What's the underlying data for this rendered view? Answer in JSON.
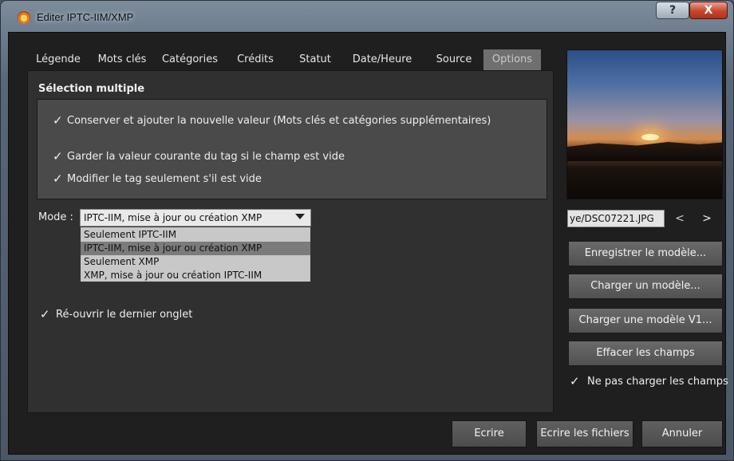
{
  "window": {
    "title": "Editer IPTC-IIM/XMP",
    "help_label": "?",
    "close_label": "X"
  },
  "tabs": [
    {
      "label": "Légende"
    },
    {
      "label": "Mots clés"
    },
    {
      "label": "Catégories"
    },
    {
      "label": "Crédits"
    },
    {
      "label": "Statut"
    },
    {
      "label": "Date/Heure"
    },
    {
      "label": "Source"
    },
    {
      "label": "Options",
      "active": true
    }
  ],
  "options": {
    "multi_title": "Sélection multiple",
    "checks": [
      {
        "label": "Conserver et ajouter la nouvelle valeur (Mots clés et catégories supplémentaires)",
        "checked": true
      },
      {
        "label": "Garder la valeur courante du tag si le champ est vide",
        "checked": true
      },
      {
        "label": "Modifier le tag seulement s'il est vide",
        "checked": true
      }
    ],
    "mode_label": "Mode :",
    "mode_value": "IPTC-IIM, mise à jour ou création XMP",
    "mode_options": [
      "Seulement IPTC-IIM",
      "IPTC-IIM, mise à jour ou création XMP",
      "Seulement XMP",
      "XMP, mise à jour ou création IPTC-IIM"
    ],
    "reopen_label": "Ré-ouvrir le dernier onglet",
    "check_glyph": "✓"
  },
  "right": {
    "filename": "ye/DSC07221.JPG",
    "prev": "<",
    "next": ">",
    "buttons": [
      "Enregistrer le modèle...",
      "Charger un modèle...",
      "Charger une modèle V1...",
      "Effacer les champs"
    ],
    "no_load_label": "Ne pas charger les champs"
  },
  "bottom": {
    "write": "Ecrire",
    "write_files": "Ecrire les fichiers",
    "cancel": "Annuler"
  }
}
